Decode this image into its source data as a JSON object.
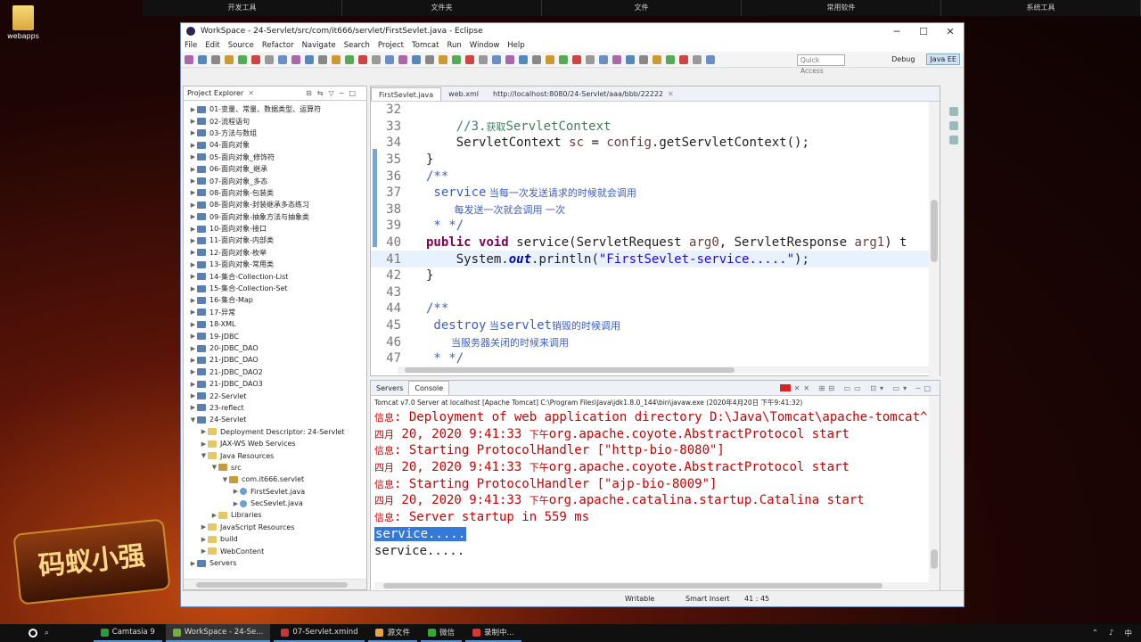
{
  "desktop": {
    "top_items": [
      "开发工具",
      "文件夹",
      "文件",
      "常用软件",
      "系统工具"
    ],
    "icon_label": "webapps",
    "logo_text": "码蚁小强"
  },
  "window": {
    "title": "WorkSpace - 24-Servlet/src/com/it666/servlet/FirstSevlet.java - Eclipse",
    "menu": [
      "File",
      "Edit",
      "Source",
      "Refactor",
      "Navigate",
      "Search",
      "Project",
      "Tomcat",
      "Run",
      "Window",
      "Help"
    ],
    "quick_access": "Quick Access",
    "perspectives": [
      "Debug",
      "Java EE"
    ]
  },
  "explorer": {
    "title": "Project Explorer",
    "items": [
      {
        "label": "01-变量、常量、数据类型、运算符",
        "indent": 0,
        "exp": "▶",
        "type": "proj"
      },
      {
        "label": "02-流程语句",
        "indent": 0,
        "exp": "▶",
        "type": "proj"
      },
      {
        "label": "03-方法与数组",
        "indent": 0,
        "exp": "▶",
        "type": "proj"
      },
      {
        "label": "04-面向对象",
        "indent": 0,
        "exp": "▶",
        "type": "proj"
      },
      {
        "label": "05-面向对象_修饰符",
        "indent": 0,
        "exp": "▶",
        "type": "proj"
      },
      {
        "label": "06-面向对象_继承",
        "indent": 0,
        "exp": "▶",
        "type": "proj"
      },
      {
        "label": "07-面向对象_多态",
        "indent": 0,
        "exp": "▶",
        "type": "proj"
      },
      {
        "label": "08-面向对象-包装类",
        "indent": 0,
        "exp": "▶",
        "type": "proj"
      },
      {
        "label": "08-面向对象-封装继承多态练习",
        "indent": 0,
        "exp": "▶",
        "type": "proj"
      },
      {
        "label": "09-面向对象-抽象方法与抽象类",
        "indent": 0,
        "exp": "▶",
        "type": "proj"
      },
      {
        "label": "10-面向对象-接口",
        "indent": 0,
        "exp": "▶",
        "type": "proj"
      },
      {
        "label": "11-面向对象-内部类",
        "indent": 0,
        "exp": "▶",
        "type": "proj"
      },
      {
        "label": "12-面向对象-枚举",
        "indent": 0,
        "exp": "▶",
        "type": "proj"
      },
      {
        "label": "13-面向对象-常用类",
        "indent": 0,
        "exp": "▶",
        "type": "proj"
      },
      {
        "label": "14-集合-Collection-List",
        "indent": 0,
        "exp": "▶",
        "type": "proj"
      },
      {
        "label": "15-集合-Collection-Set",
        "indent": 0,
        "exp": "▶",
        "type": "proj"
      },
      {
        "label": "16-集合-Map",
        "indent": 0,
        "exp": "▶",
        "type": "proj"
      },
      {
        "label": "17-异常",
        "indent": 0,
        "exp": "▶",
        "type": "proj"
      },
      {
        "label": "18-XML",
        "indent": 0,
        "exp": "▶",
        "type": "proj"
      },
      {
        "label": "19-JDBC",
        "indent": 0,
        "exp": "▶",
        "type": "proj"
      },
      {
        "label": "20-JDBC_DAO",
        "indent": 0,
        "exp": "▶",
        "type": "proj"
      },
      {
        "label": "21-JDBC_DAO",
        "indent": 0,
        "exp": "▶",
        "type": "proj"
      },
      {
        "label": "21-JDBC_DAO2",
        "indent": 0,
        "exp": "▶",
        "type": "proj"
      },
      {
        "label": "21-JDBC_DAO3",
        "indent": 0,
        "exp": "▶",
        "type": "proj"
      },
      {
        "label": "22-Servlet",
        "indent": 0,
        "exp": "▶",
        "type": "proj"
      },
      {
        "label": "23-reflect",
        "indent": 0,
        "exp": "▶",
        "type": "proj"
      },
      {
        "label": "24-Servlet",
        "indent": 0,
        "exp": "▼",
        "type": "proj"
      },
      {
        "label": "Deployment Descriptor: 24-Servlet",
        "indent": 1,
        "exp": "▶",
        "type": "fold"
      },
      {
        "label": "JAX-WS Web Services",
        "indent": 1,
        "exp": "▶",
        "type": "fold"
      },
      {
        "label": "Java Resources",
        "indent": 1,
        "exp": "▼",
        "type": "fold"
      },
      {
        "label": "src",
        "indent": 2,
        "exp": "▼",
        "type": "pkg"
      },
      {
        "label": "com.it666.servlet",
        "indent": 3,
        "exp": "▼",
        "type": "pkg"
      },
      {
        "label": "FirstSevlet.java",
        "indent": 4,
        "exp": "▶",
        "type": "java"
      },
      {
        "label": "SecSevlet.java",
        "indent": 4,
        "exp": "▶",
        "type": "java"
      },
      {
        "label": "Libraries",
        "indent": 2,
        "exp": "▶",
        "type": "fold"
      },
      {
        "label": "JavaScript Resources",
        "indent": 1,
        "exp": "▶",
        "type": "fold"
      },
      {
        "label": "build",
        "indent": 1,
        "exp": "▶",
        "type": "fold"
      },
      {
        "label": "WebContent",
        "indent": 1,
        "exp": "▶",
        "type": "fold"
      },
      {
        "label": "Servers",
        "indent": 0,
        "exp": "▶",
        "type": "proj"
      }
    ]
  },
  "editor": {
    "tabs": [
      "FirstSevlet.java",
      "web.xml",
      "http://localhost:8080/24-Servlet/aaa/bbb/22222"
    ],
    "lines": [
      {
        "n": "32",
        "text": ""
      },
      {
        "n": "33",
        "text": "    //3.获取ServletContext"
      },
      {
        "n": "34",
        "text": "    ServletContext sc = config.getServletContext();"
      },
      {
        "n": "35",
        "text": "}"
      },
      {
        "n": "36",
        "text": "/**"
      },
      {
        "n": "37",
        "text": " service 当每一次发送请求的时候就会调用"
      },
      {
        "n": "38",
        "text": "         每发送一次就会调用 一次"
      },
      {
        "n": "39",
        "text": " * */"
      },
      {
        "n": "40",
        "text": "public void service(ServletRequest arg0, ServletResponse arg1) t"
      },
      {
        "n": "41",
        "text": "    System.out.println(\"FirstSevlet-service.....\");"
      },
      {
        "n": "42",
        "text": "}"
      },
      {
        "n": "43",
        "text": ""
      },
      {
        "n": "44",
        "text": "/**"
      },
      {
        "n": "45",
        "text": " destroy 当servlet销毁的时候调用"
      },
      {
        "n": "46",
        "text": "        当服务器关闭的时候来调用"
      },
      {
        "n": "47",
        "text": " * */"
      }
    ]
  },
  "console": {
    "tabs": [
      "Servers",
      "Console"
    ],
    "header": "Tomcat v7.0 Server at localhost [Apache Tomcat] C:\\Program Files\\Java\\jdk1.8.0_144\\bin\\javaw.exe (2020年4月20日 下午9:41:32)",
    "lines": [
      {
        "label": "信息",
        "text": ": Deployment of web application directory D:\\Java\\Tomcat\\apache-tomcat^",
        "red": true
      },
      {
        "label": "四月",
        "text": " 20, 2020 9:41:33 ",
        "label2": "下午",
        "text2": "org.apache.coyote.AbstractProtocol start",
        "red": true
      },
      {
        "label": "信息",
        "text": ": Starting ProtocolHandler [\"http-bio-8080\"]",
        "red": true
      },
      {
        "label": "四月",
        "text": " 20, 2020 9:41:33 ",
        "label2": "下午",
        "text2": "org.apache.coyote.AbstractProtocol start",
        "red": true
      },
      {
        "label": "信息",
        "text": ": Starting ProtocolHandler [\"ajp-bio-8009\"]",
        "red": true
      },
      {
        "label": "四月",
        "text": " 20, 2020 9:41:33 ",
        "label2": "下午",
        "text2": "org.apache.catalina.startup.Catalina start",
        "red": true
      },
      {
        "label": "信息",
        "text": ": Server startup in 559 ms",
        "red": true
      },
      {
        "label": "",
        "text": "service.....",
        "red": false,
        "selected": true
      },
      {
        "label": "",
        "text": "service.....",
        "red": false
      }
    ]
  },
  "status": {
    "writable": "Writable",
    "insert": "Smart Insert",
    "position": "41 : 45"
  },
  "taskbar": {
    "items": [
      "Camtasia 9",
      "WorkSpace - 24-Se...",
      "07-Servlet.xmind",
      "源文件",
      "微信",
      "录制中..."
    ],
    "tray": "中"
  }
}
